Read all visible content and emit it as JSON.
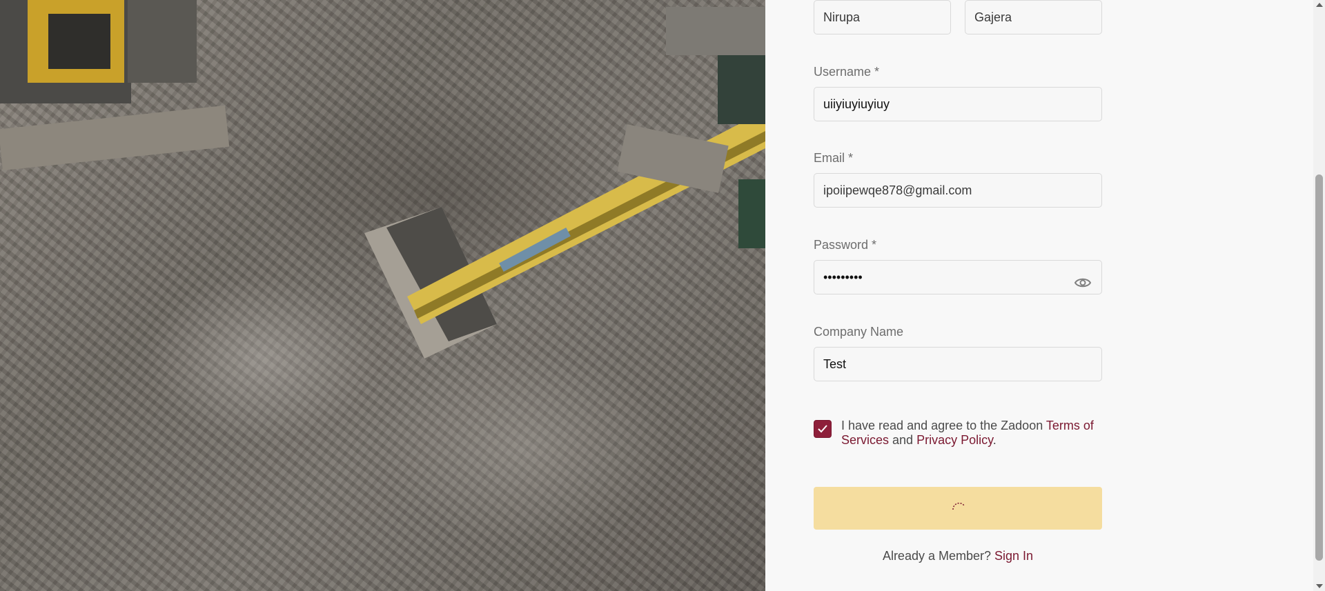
{
  "form": {
    "first_name_value": "Nirupa",
    "last_name_value": "Gajera",
    "username_label": "Username *",
    "username_value": "uiiyiuyiuyiuy",
    "email_label": "Email *",
    "email_value": "ipoiipewqe878@gmail.com",
    "password_label": "Password *",
    "password_value": "•••••••••",
    "company_label": "Company Name",
    "company_value": "Test",
    "agree_checked": true,
    "agree_prefix": "I have read and agree to the Zadoon ",
    "terms_link": "Terms of Services",
    "agree_middle": " and ",
    "privacy_link": "Privacy Policy",
    "agree_suffix": ".",
    "submit_loading": true,
    "member_prompt": "Already a Member? ",
    "sign_in_link": "Sign In"
  },
  "colors": {
    "accent": "#7a1830",
    "submit_bg": "#f5dd9f",
    "checkbox_bg": "#8e1f3a"
  },
  "icons": {
    "password_toggle": "eye-icon",
    "checkbox_mark": "check-icon",
    "loading": "spinner-icon"
  }
}
